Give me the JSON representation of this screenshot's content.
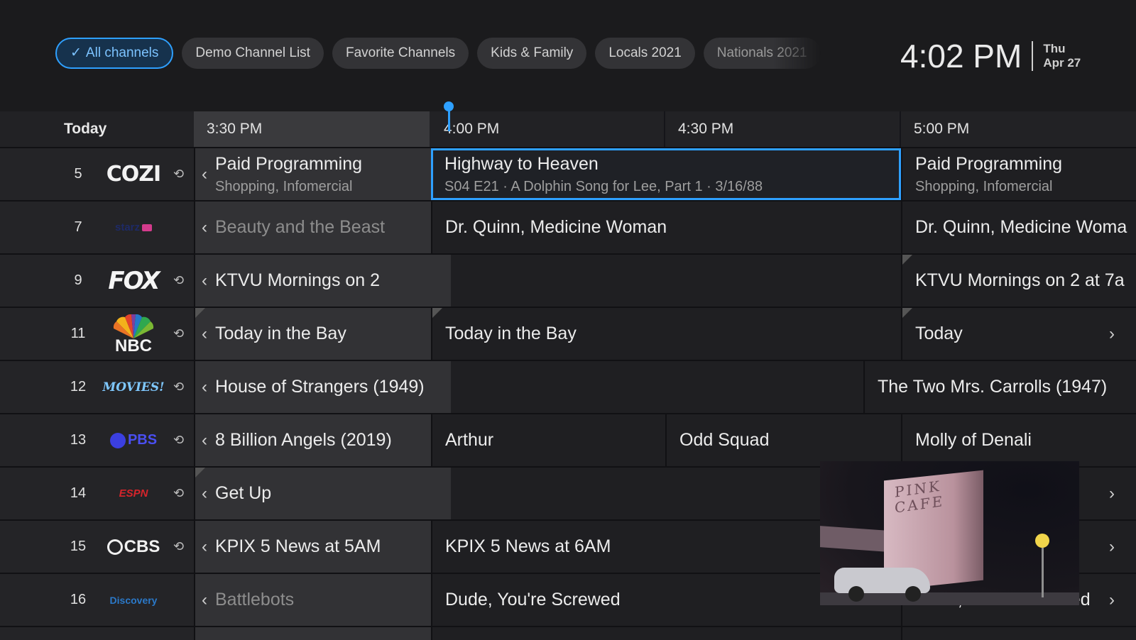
{
  "filters": {
    "chips": [
      {
        "label": "All channels",
        "active": true
      },
      {
        "label": "Demo Channel List",
        "active": false
      },
      {
        "label": "Favorite Channels",
        "active": false
      },
      {
        "label": "Kids & Family",
        "active": false
      },
      {
        "label": "Locals 2021",
        "active": false
      },
      {
        "label": "Nationals 2021",
        "active": false
      }
    ]
  },
  "clock": {
    "time": "4:02 PM",
    "day": "Thu",
    "date": "Apr 27"
  },
  "timeline": {
    "day_label": "Today",
    "slots": [
      "3:30 PM",
      "4:00 PM",
      "4:30 PM",
      "5:00 PM"
    ]
  },
  "accent_color": "#2ea0ff",
  "channels": [
    {
      "number": "5",
      "logo": "COZI",
      "record_icon": true,
      "programs": [
        {
          "title": "Paid Programming",
          "subtitle": "Shopping, Infomercial"
        },
        {
          "title": "Highway to Heaven",
          "subtitle": "S04 E21 · A Dolphin Song for Lee, Part 1 · 3/16/88",
          "selected": true
        },
        {
          "title": "Paid Programming",
          "subtitle": "Shopping, Infomercial"
        }
      ]
    },
    {
      "number": "7",
      "logo": "starz",
      "record_icon": false,
      "programs": [
        {
          "title": "Beauty and the Beast"
        },
        {
          "title": "Dr. Quinn, Medicine Woman"
        },
        {
          "title": "Dr. Quinn, Medicine Woma"
        }
      ]
    },
    {
      "number": "9",
      "logo": "FOX",
      "record_icon": true,
      "programs": [
        {
          "title": "KTVU Mornings on 2"
        },
        {
          "title": "KTVU Mornings on 2 at 7a"
        }
      ]
    },
    {
      "number": "11",
      "logo": "NBC",
      "record_icon": true,
      "programs": [
        {
          "title": "Today in the Bay"
        },
        {
          "title": "Today in the Bay"
        },
        {
          "title": "Today"
        }
      ]
    },
    {
      "number": "12",
      "logo": "MOVIES!",
      "record_icon": true,
      "programs": [
        {
          "title": "House of Strangers (1949)"
        },
        {
          "title": "The Two Mrs. Carrolls (1947)"
        }
      ]
    },
    {
      "number": "13",
      "logo": "PBS",
      "record_icon": true,
      "programs": [
        {
          "title": "8 Billion Angels (2019)"
        },
        {
          "title": "Arthur"
        },
        {
          "title": "Odd Squad"
        },
        {
          "title": "Molly of Denali"
        }
      ]
    },
    {
      "number": "14",
      "logo": "ESPN",
      "record_icon": true,
      "programs": [
        {
          "title": "Get Up"
        }
      ]
    },
    {
      "number": "15",
      "logo": "CBS",
      "record_icon": true,
      "programs": [
        {
          "title": "KPIX 5 News at 5AM"
        },
        {
          "title": "KPIX 5 News at 6AM"
        }
      ]
    },
    {
      "number": "16",
      "logo": "Discovery",
      "record_icon": false,
      "programs": [
        {
          "title": "Battlebots"
        },
        {
          "title": "Dude, You're Screwed"
        },
        {
          "title": "Dude, You're Screwed"
        }
      ]
    }
  ],
  "preview": {
    "sign_text": "PINK CAFE"
  }
}
